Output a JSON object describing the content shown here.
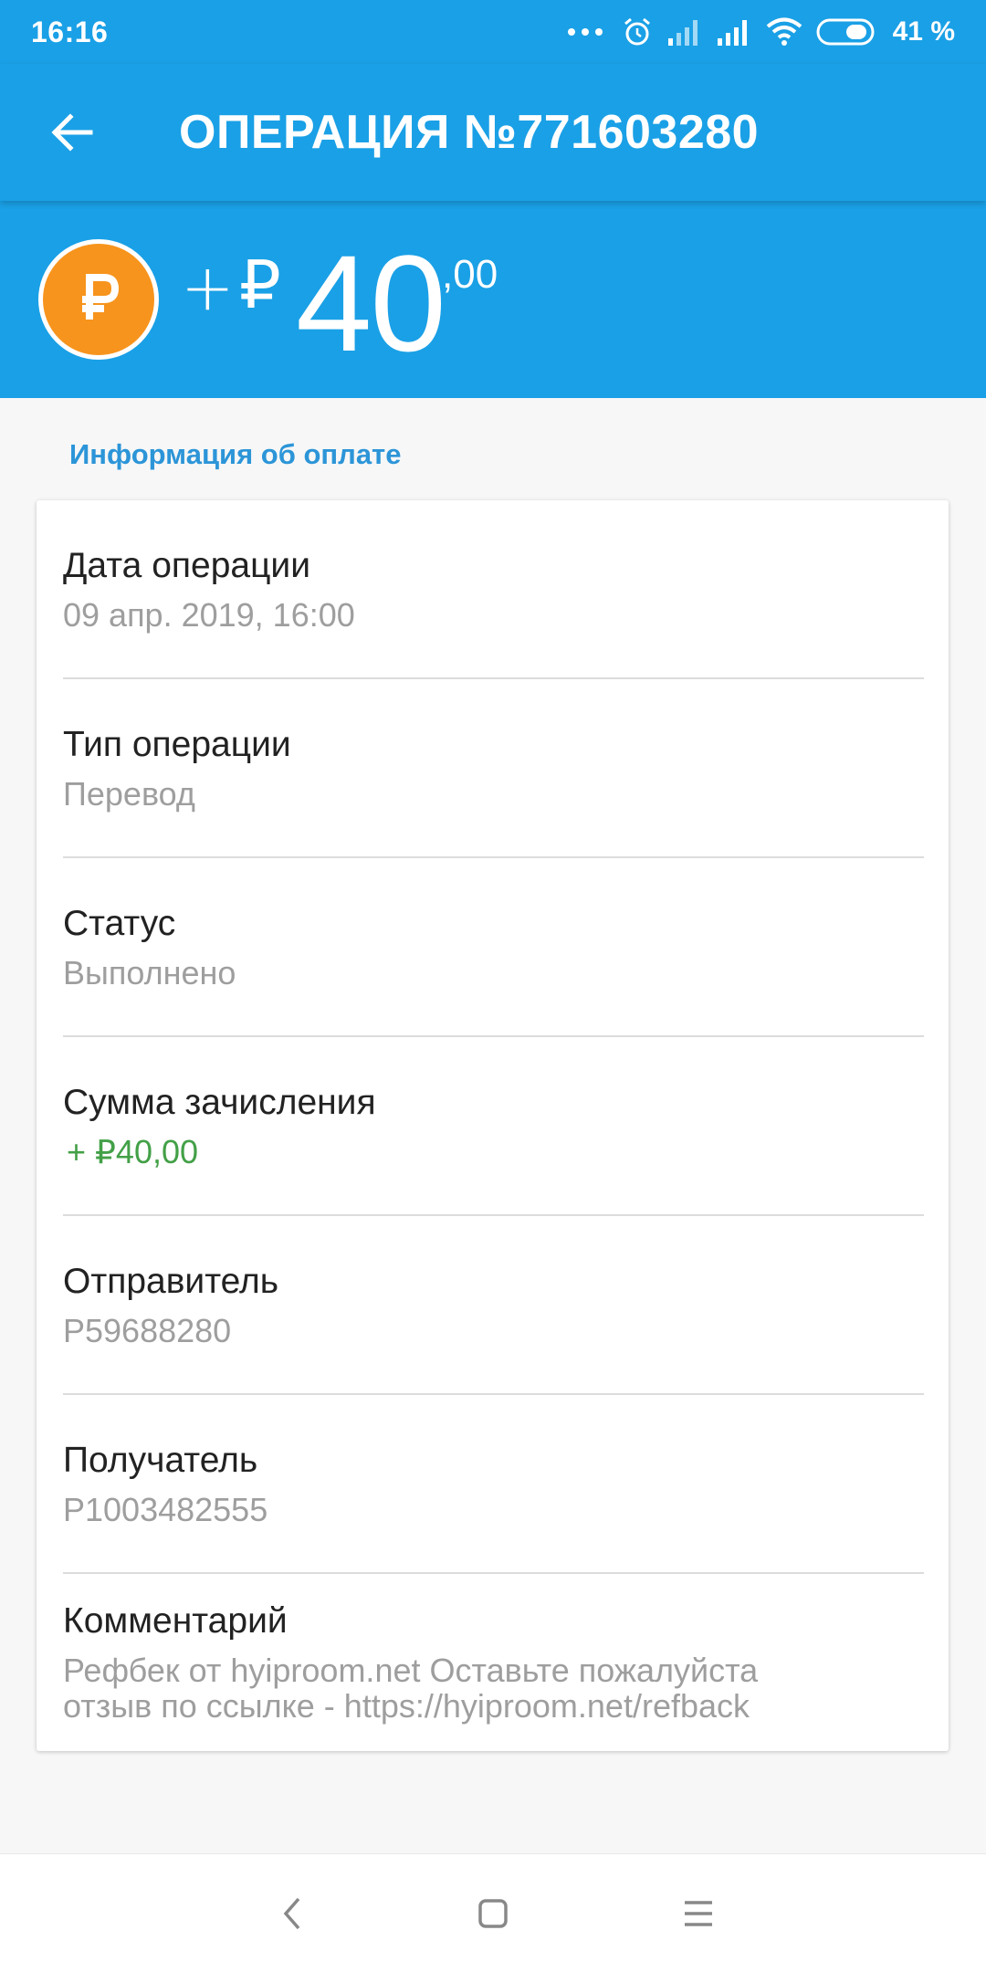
{
  "status_bar": {
    "time": "16:16",
    "battery_percent": "41 %",
    "icons": [
      "more-dots-icon",
      "alarm-icon",
      "signal-icon",
      "signal-icon",
      "wifi-icon",
      "battery-icon"
    ]
  },
  "app_bar": {
    "title": "ОПЕРАЦИЯ №771603280",
    "back_icon": "arrow-back-icon"
  },
  "amount": {
    "sign": "+",
    "currency": "₽",
    "integer": "40",
    "fraction": ",00",
    "coin_symbol": "₽"
  },
  "section": {
    "title": "Информация об оплате"
  },
  "details": [
    {
      "label": "Дата операции",
      "value": "09 апр. 2019, 16:00"
    },
    {
      "label": "Тип операции",
      "value": "Перевод"
    },
    {
      "label": "Статус",
      "value": "Выполнено"
    },
    {
      "label": "Сумма зачисления",
      "value": "+ ₽40,00"
    },
    {
      "label": "Отправитель",
      "value": "P59688280"
    },
    {
      "label": "Получатель",
      "value": "P1003482555"
    },
    {
      "label": "Комментарий",
      "value_line1": "Рефбек от hyiproom.net  Оставьте пожалуйста",
      "value_line2": "отзыв по ссылке - https://hyiproom.net/refback"
    }
  ],
  "colors": {
    "primary": "#1aa0e6",
    "section_title": "#2c95d8",
    "coin": "#f7941d",
    "credit_green": "#43a047"
  },
  "nav_bar": {
    "icons": [
      "back-nav-icon",
      "home-nav-icon",
      "menu-nav-icon"
    ]
  }
}
